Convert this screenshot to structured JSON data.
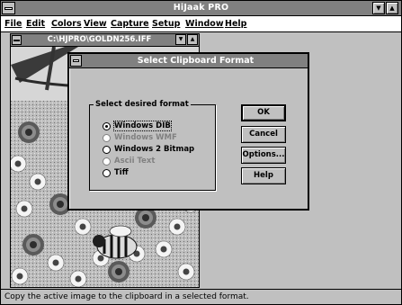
{
  "app": {
    "title": "HiJaak PRO",
    "menu": [
      "File",
      "Edit",
      "Colors",
      "View",
      "Capture",
      "Setup",
      "Window",
      "Help"
    ]
  },
  "child_window": {
    "title": "C:\\HJPRO\\GOLDN256.IFF"
  },
  "dialog": {
    "title": "Select Clipboard Format",
    "group_label": "Select desired format",
    "options": [
      {
        "label": "Windows DIB",
        "selected": true,
        "enabled": true
      },
      {
        "label": "Windows WMF",
        "selected": false,
        "enabled": false
      },
      {
        "label": "Windows 2 Bitmap",
        "selected": false,
        "enabled": true
      },
      {
        "label": "Ascii Text",
        "selected": false,
        "enabled": false
      },
      {
        "label": "Tiff",
        "selected": false,
        "enabled": true
      }
    ],
    "buttons": {
      "ok": "OK",
      "cancel": "Cancel",
      "options": "Options...",
      "help": "Help"
    }
  },
  "status": {
    "text": "Copy the active image to the clipboard in a selected format."
  },
  "icons": [
    "system-menu-icon",
    "minimize-icon",
    "maximize-icon"
  ]
}
